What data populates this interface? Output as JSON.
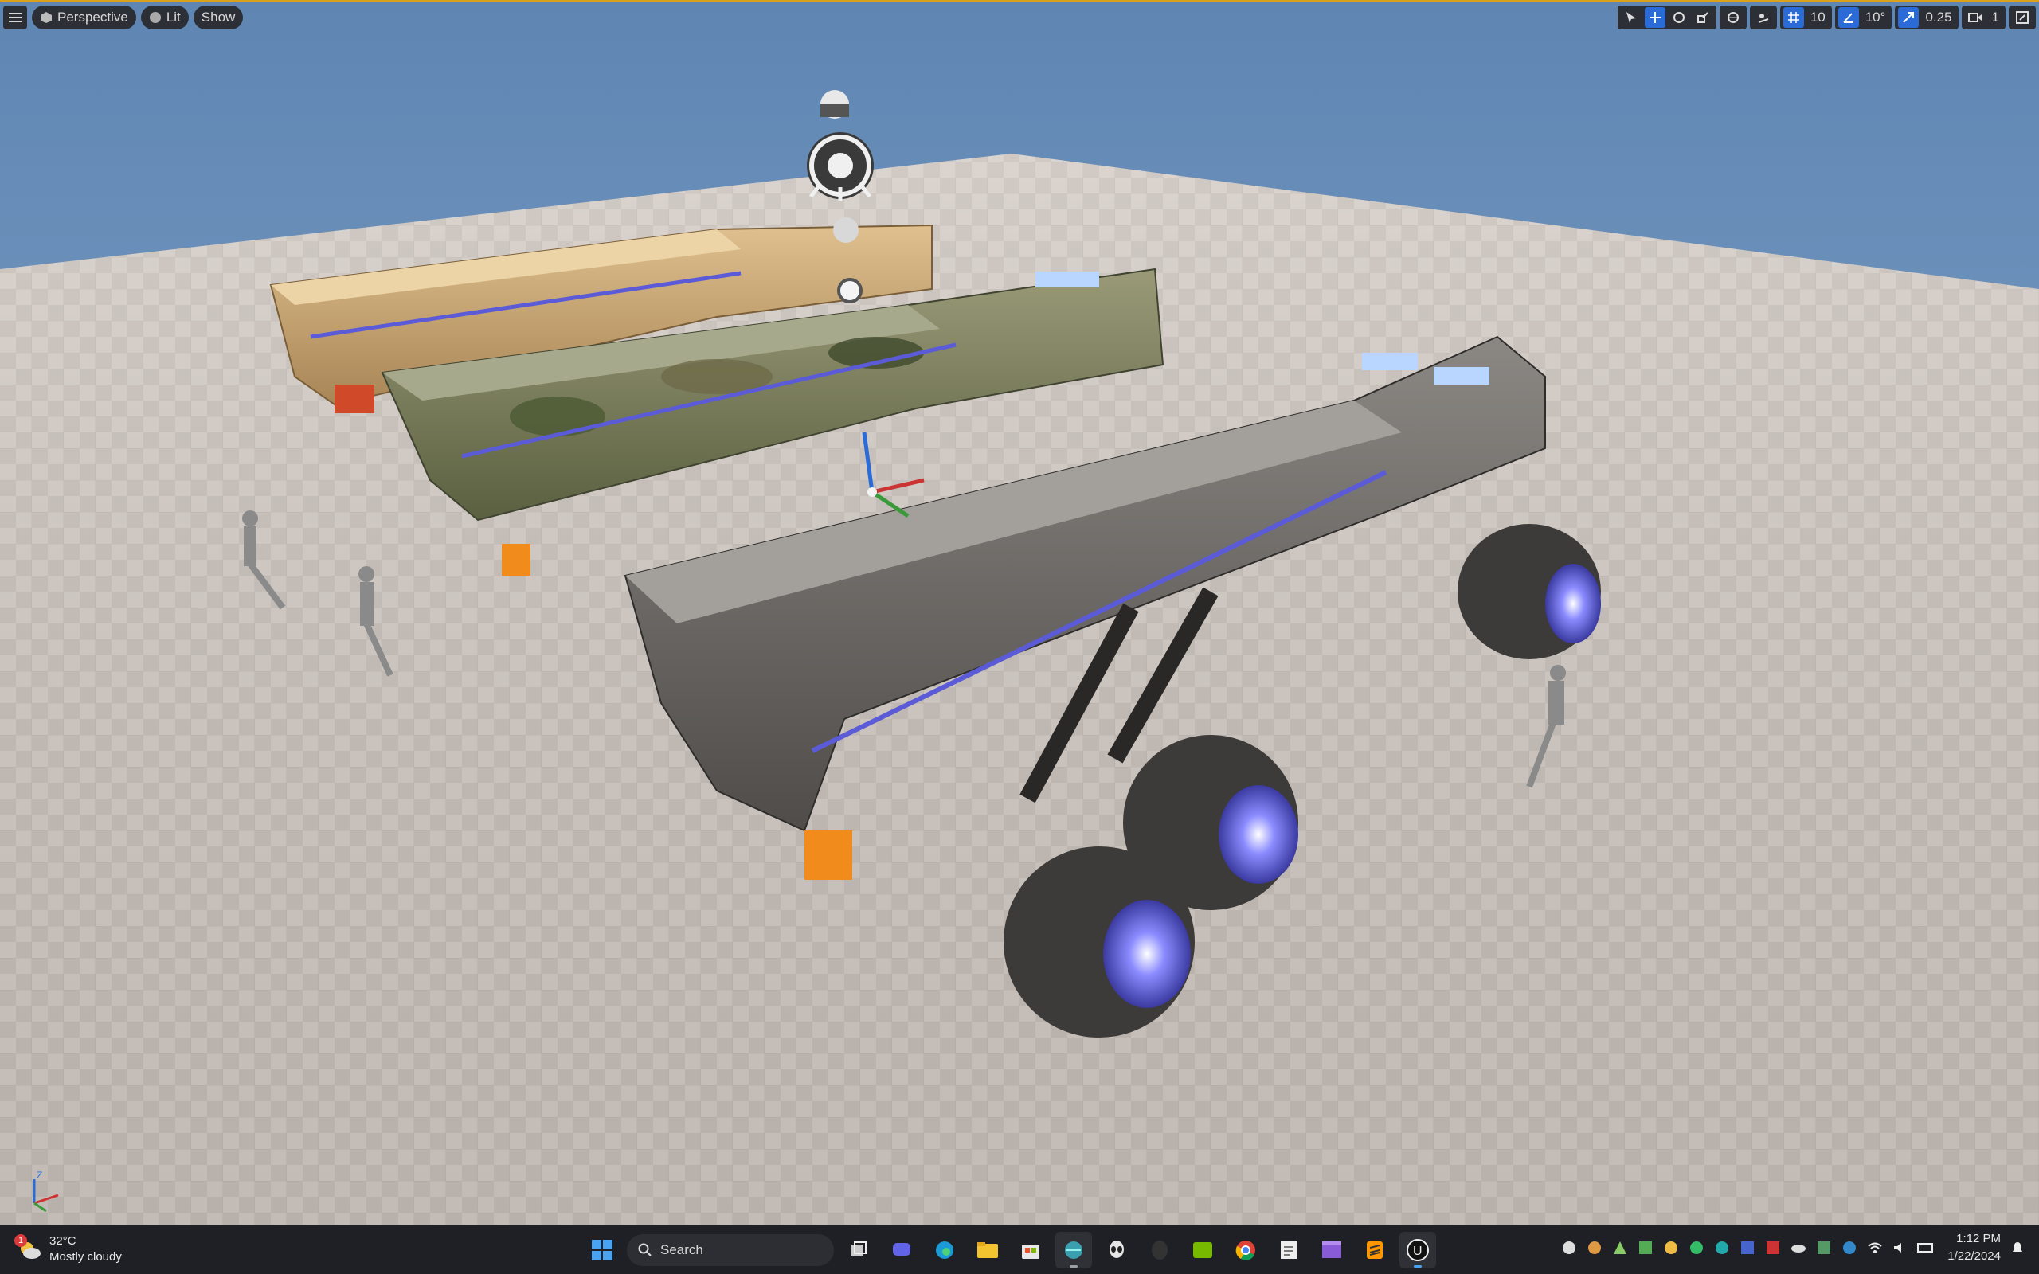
{
  "viewport": {
    "toolbar_left": {
      "menu_icon": "hamburger-icon",
      "perspective_label": "Perspective",
      "lit_label": "Lit",
      "show_label": "Show"
    },
    "toolbar_right": {
      "grid_snap_value": "10",
      "rotation_snap_value": "10°",
      "scale_snap_value": "0.25",
      "camera_speed_value": "1"
    },
    "accent_color": "#2a6bd8",
    "border_color": "#d9a21a"
  },
  "taskbar": {
    "weather": {
      "badge": "1",
      "temperature": "32°C",
      "condition": "Mostly cloudy"
    },
    "search_placeholder": "Search",
    "apps": [
      "start-icon",
      "search",
      "task-view-icon",
      "chat-icon",
      "edge-icon",
      "file-explorer-icon",
      "store-icon",
      "app-globe-icon",
      "alien-icon",
      "dark-app-icon",
      "nvidia-icon",
      "chrome-icon",
      "notepad-icon",
      "clapper-icon",
      "sublime-icon",
      "unreal-icon"
    ],
    "clock": {
      "time": "1:12 PM",
      "date": "1/22/2024"
    }
  }
}
